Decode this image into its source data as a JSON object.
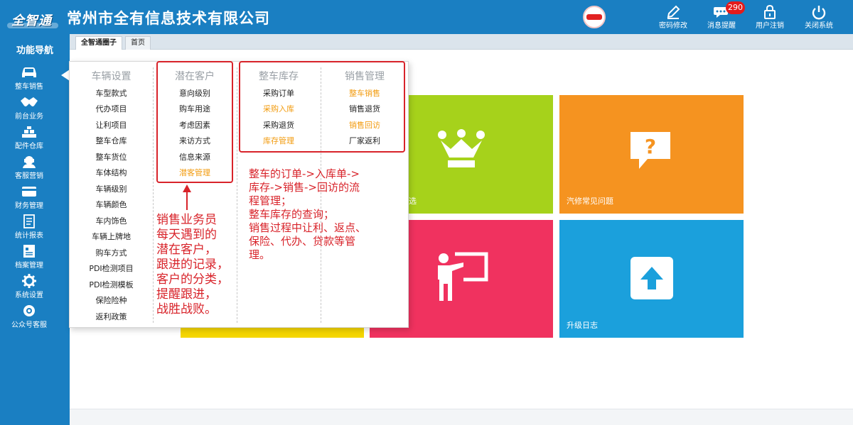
{
  "app": {
    "logo_text": "全智通",
    "company": "常州市全有信息技术有限公司"
  },
  "header_actions": [
    {
      "name": "password-change",
      "label": "密码修改"
    },
    {
      "name": "message-alert",
      "label": "消息提醒",
      "badge": "290"
    },
    {
      "name": "user-logout",
      "label": "用户注销"
    },
    {
      "name": "close-system",
      "label": "关闭系统"
    }
  ],
  "sidebar": {
    "title": "功能导航",
    "items": [
      {
        "label": "整车销售",
        "icon": "car-icon"
      },
      {
        "label": "前台业务",
        "icon": "handshake-icon"
      },
      {
        "label": "配件仓库",
        "icon": "warehouse-icon"
      },
      {
        "label": "客服营销",
        "icon": "headset-icon"
      },
      {
        "label": "财务管理",
        "icon": "card-icon"
      },
      {
        "label": "统计报表",
        "icon": "report-icon"
      },
      {
        "label": "档案管理",
        "icon": "archive-icon"
      },
      {
        "label": "系统设置",
        "icon": "gear-icon"
      },
      {
        "label": "公众号客服",
        "icon": "service-icon"
      }
    ]
  },
  "tabs": [
    {
      "label": "全智通圈子",
      "active": true
    },
    {
      "label": "首页",
      "active": false
    }
  ],
  "menu": {
    "columns": [
      {
        "title": "车辆设置",
        "items": [
          {
            "label": "车型款式",
            "hl": false
          },
          {
            "label": "代办项目",
            "hl": false
          },
          {
            "label": "让利项目",
            "hl": false
          },
          {
            "label": "整车仓库",
            "hl": false
          },
          {
            "label": "整车货位",
            "hl": false
          },
          {
            "label": "车体结构",
            "hl": false
          },
          {
            "label": "车辆级别",
            "hl": false
          },
          {
            "label": "车辆颜色",
            "hl": false
          },
          {
            "label": "车内饰色",
            "hl": false
          },
          {
            "label": "车辆上牌地",
            "hl": false
          },
          {
            "label": "购车方式",
            "hl": false
          },
          {
            "label": "PDI检测项目",
            "hl": false
          },
          {
            "label": "PDI检测模板",
            "hl": false
          },
          {
            "label": "保险险种",
            "hl": false
          },
          {
            "label": "返利政策",
            "hl": false
          }
        ]
      },
      {
        "title": "潜在客户",
        "items": [
          {
            "label": "意向级别",
            "hl": false
          },
          {
            "label": "购车用途",
            "hl": false
          },
          {
            "label": "考虑因素",
            "hl": false
          },
          {
            "label": "来访方式",
            "hl": false
          },
          {
            "label": "信息来源",
            "hl": false
          },
          {
            "label": "潜客管理",
            "hl": true
          }
        ]
      },
      {
        "title": "整车库存",
        "items": [
          {
            "label": "采购订单",
            "hl": false
          },
          {
            "label": "采购入库",
            "hl": true
          },
          {
            "label": "采购退货",
            "hl": false
          },
          {
            "label": "库存管理",
            "hl": true
          }
        ]
      },
      {
        "title": "销售管理",
        "items": [
          {
            "label": "整车销售",
            "hl": true
          },
          {
            "label": "销售退货",
            "hl": false
          },
          {
            "label": "销售回访",
            "hl": true
          },
          {
            "label": "厂家返利",
            "hl": false
          }
        ]
      }
    ]
  },
  "tiles": [
    {
      "label": "选",
      "color": "#a6d21b",
      "icon": "crown-icon"
    },
    {
      "label": "汽修常见问题",
      "color": "#f59320",
      "icon": "question-icon"
    },
    {
      "label": "",
      "color": "#f0325f",
      "icon": "presenter-icon"
    },
    {
      "label": "升级日志",
      "color": "#1ba0dc",
      "icon": "upload-icon"
    },
    {
      "label": "",
      "color": "#f5d600",
      "icon": ""
    }
  ],
  "annotations": {
    "note1": [
      "销售业务员",
      "每天遇到的",
      "潜在客户，",
      "跟进的记录，",
      "客户的分类，",
      "提醒跟进，",
      "战胜战败。"
    ],
    "note2": [
      "整车的订单->入库单->",
      "库存->销售->回访的流",
      "程管理；",
      "整车库存的查询；",
      "销售过程中让利、返点、",
      "保险、代办、贷款等管",
      "理。"
    ]
  },
  "colors": {
    "primary": "#1a7fc2",
    "highlight": "#f29b0e",
    "annotation": "#d8232a"
  }
}
